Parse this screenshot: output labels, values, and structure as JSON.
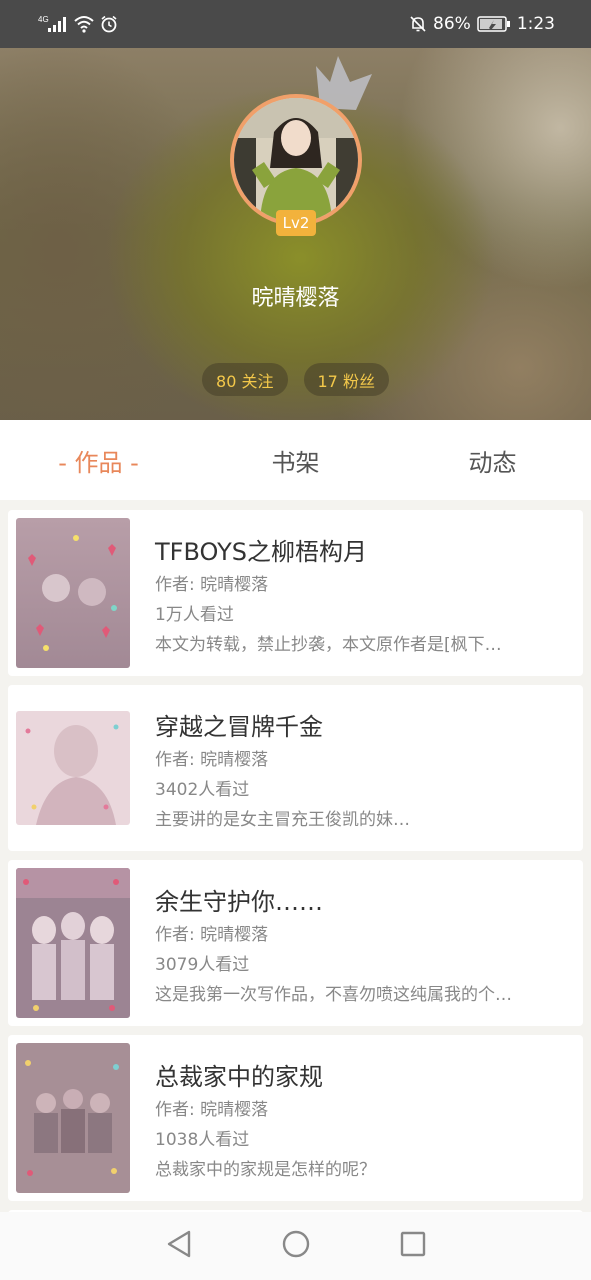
{
  "status_bar": {
    "network": "4G",
    "battery_percent": "86%",
    "time": "1:23"
  },
  "profile": {
    "level": "Lv2",
    "username": "晥晴樱落",
    "following": "80 关注",
    "followers": "17 粉丝"
  },
  "tabs": [
    {
      "label": "- 作品 -",
      "active": true
    },
    {
      "label": "书架",
      "active": false
    },
    {
      "label": "动态",
      "active": false
    }
  ],
  "works": [
    {
      "title": "TFBOYS之柳梧构月",
      "author": "作者: 晥晴樱落",
      "views": "1万人看过",
      "description": "本文为转载，禁止抄袭，本文原作者是[枫下…"
    },
    {
      "title": "穿越之冒牌千金",
      "author": "作者: 晥晴樱落",
      "views": "3402人看过",
      "description": "主要讲的是女主冒充王俊凯的妹…"
    },
    {
      "title": "余生守护你……",
      "author": "作者: 晥晴樱落",
      "views": "3079人看过",
      "description": "这是我第一次写作品，不喜勿喷这纯属我的个…"
    },
    {
      "title": "总裁家中的家规",
      "author": "作者: 晥晴樱落",
      "views": "1038人看过",
      "description": "总裁家中的家规是怎样的呢？"
    }
  ],
  "colors": {
    "accent": "#e8875a",
    "stat_text": "#f3c84a",
    "badge": "#f2b23c"
  }
}
